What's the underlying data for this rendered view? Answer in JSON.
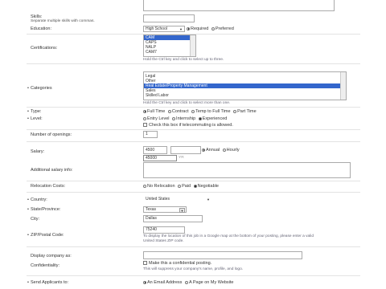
{
  "skills": {
    "label": "Skills:",
    "hint": "Separate multiple skills with commas."
  },
  "education": {
    "label": "Education:",
    "selected": "High School",
    "options": [
      {
        "label": "Required",
        "checked": true
      },
      {
        "label": "Preferred",
        "checked": false
      }
    ]
  },
  "certifications": {
    "label": "Certifications:",
    "items": [
      {
        "label": "CAM",
        "selected": true
      },
      {
        "label": "CAPS",
        "selected": false
      },
      {
        "label": "NALP",
        "selected": false
      },
      {
        "label": "CAM7",
        "selected": false
      }
    ],
    "hint": "Hold the Ctrl key and click to select up to three."
  },
  "categories": {
    "label": "Categories",
    "items": [
      {
        "label": "Legal",
        "selected": false
      },
      {
        "label": "Other",
        "selected": false
      },
      {
        "label": "Real Estate/Property Management",
        "selected": true
      },
      {
        "label": "Sales",
        "selected": false
      },
      {
        "label": "Skilled Labor",
        "selected": false
      }
    ],
    "hint": "Hold the Ctrl key and click to select more than one."
  },
  "type": {
    "label": "Type:",
    "options": [
      {
        "label": "Full Time",
        "checked": true
      },
      {
        "label": "Contract",
        "checked": false
      },
      {
        "label": "Temp to Full Time",
        "checked": false
      },
      {
        "label": "Part Time",
        "checked": false
      }
    ]
  },
  "level": {
    "label": "Level:",
    "options": [
      {
        "label": "Entry Level",
        "checked": false
      },
      {
        "label": "Internship",
        "checked": false
      },
      {
        "label": "Experienced",
        "checked": true
      }
    ]
  },
  "telecommuting": {
    "label": "Check this box if telecommuting is allowed.",
    "checked": false
  },
  "openings": {
    "label": "Number of openings:",
    "value": "1"
  },
  "salary": {
    "label": "Salary:",
    "value": "4500",
    "suggestion": "45000",
    "suffix": "YR",
    "options": [
      {
        "label": "Annual",
        "checked": true
      },
      {
        "label": "Hourly",
        "checked": false
      }
    ]
  },
  "additional_salary": {
    "label": "Additional salary info:"
  },
  "relocation": {
    "label": "Relocation Costs:",
    "options": [
      {
        "label": "No Relocation",
        "checked": false
      },
      {
        "label": "Paid",
        "checked": false
      },
      {
        "label": "Negotiable",
        "checked": true
      }
    ]
  },
  "country": {
    "label": "Country:",
    "value": "United States"
  },
  "state": {
    "label": "State/Province:",
    "value": "Texas"
  },
  "city": {
    "label": "City:",
    "value": "Dallas"
  },
  "zip": {
    "label": "ZIP/Postal Code:",
    "value": "75240",
    "hint_line1": "To display the location of this job in a Google map at the bottom of your posting, please enter a valid",
    "hint_line2": "United States ZIP code."
  },
  "display_company": {
    "label": "Display company as:",
    "value": ""
  },
  "confidentiality": {
    "label": "Confidentiality:",
    "checkbox_label": "Make this a confidential posting.",
    "hint": "This will suppress your company's name, profile, and logo.",
    "checked": false
  },
  "send_applicants": {
    "label": "Send Applicants to:",
    "options": [
      {
        "label": "An Email Address",
        "checked": true
      },
      {
        "label": "A Page on My Website",
        "checked": false
      }
    ]
  },
  "colors": {
    "selection": "#3366cc",
    "hint": "#667788",
    "border": "#aaaaaa"
  }
}
